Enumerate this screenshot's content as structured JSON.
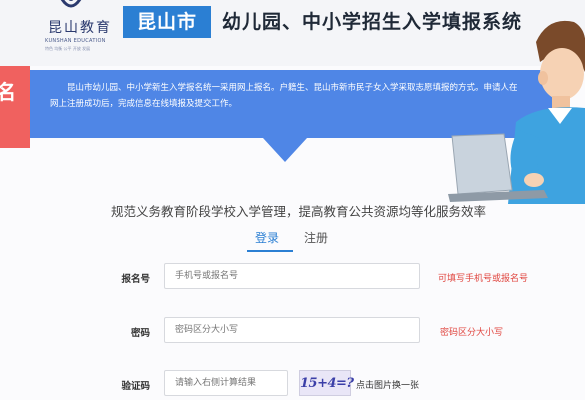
{
  "header": {
    "logo_text": "昆山教育",
    "logo_en": "KUNSHAN EDUCATION",
    "logo_tagline": "特色 均衡 公平 开放 发展",
    "city": "昆山市",
    "system_title": "幼儿园、中小学招生入学填报系统"
  },
  "banner": {
    "side_char": "名",
    "text": "昆山市幼儿园、中小学新生入学报名统一采用网上报名。户籍生、昆山市新市民子女入学采取志愿填报的方式。申请人在网上注册成功后，完成信息在线填报及提交工作。"
  },
  "form": {
    "slogan": "规范义务教育阶段学校入学管理，提高教育公共资源均等化服务效率",
    "tabs": {
      "login": "登录",
      "register": "注册"
    },
    "fields": {
      "account": {
        "label": "报名号",
        "placeholder": "手机号或报名号",
        "hint": "可填写手机号或报名号"
      },
      "password": {
        "label": "密码",
        "placeholder": "密码区分大小写",
        "hint": "密码区分大小写"
      },
      "captcha": {
        "label": "验证码",
        "placeholder": "请输入右侧计算结果",
        "image_text": "15+4=?",
        "refresh": "点击图片换一张"
      }
    }
  },
  "colors": {
    "accent": "#2b7fd3",
    "banner": "#4f86e6",
    "hint": "#e0453f"
  }
}
